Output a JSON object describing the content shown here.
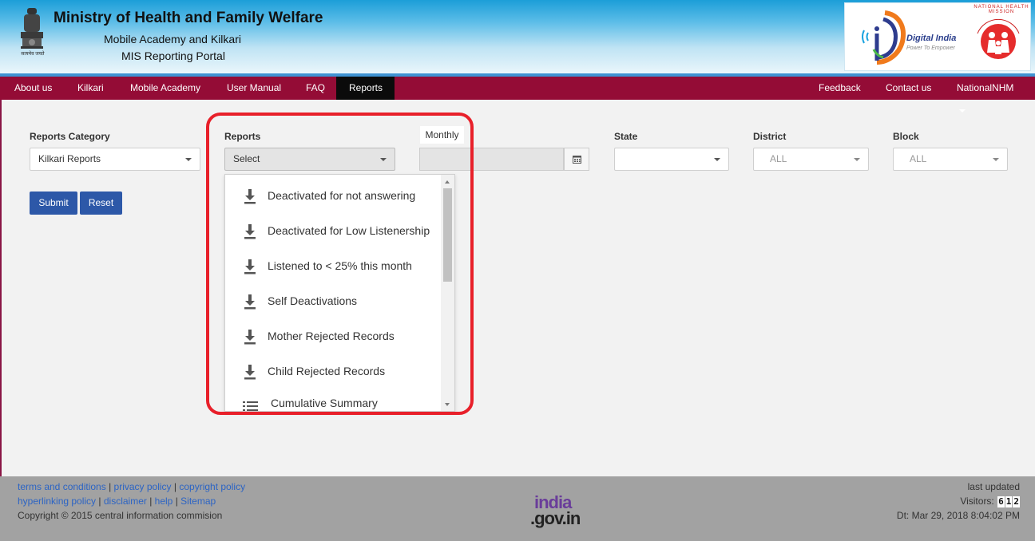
{
  "header": {
    "title": "Ministry of Health and Family Welfare",
    "subtitle1": "Mobile Academy and Kilkari",
    "subtitle2": "MIS Reporting Portal",
    "emblem_text": "सत्यमेव जयते",
    "digital_india": "Digital India",
    "digital_india_tagline": "Power To Empower",
    "nhm_text": "NATIONAL HEALTH MISSION"
  },
  "nav": {
    "left": [
      "About us",
      "Kilkari",
      "Mobile Academy",
      "User Manual",
      "FAQ",
      "Reports"
    ],
    "active": "Reports",
    "right": [
      "Feedback",
      "Contact us",
      "NationalNHM"
    ]
  },
  "filters": {
    "reports_category_label": "Reports Category",
    "reports_category_value": "Kilkari Reports",
    "reports_label": "Reports",
    "reports_value": "Select",
    "period_label": "Monthly",
    "state_label": "State",
    "state_value": "",
    "district_label": "District",
    "district_value": "ALL",
    "block_label": "Block",
    "block_value": "ALL"
  },
  "buttons": {
    "submit": "Submit",
    "reset": "Reset"
  },
  "dropdown": {
    "items": [
      {
        "label": "Deactivated for not answering",
        "icon": "download-icon"
      },
      {
        "label": "Deactivated for Low Listenership",
        "icon": "download-icon"
      },
      {
        "label": "Listened to < 25% this month",
        "icon": "download-icon"
      },
      {
        "label": "Self Deactivations",
        "icon": "download-icon"
      },
      {
        "label": "Mother Rejected Records",
        "icon": "download-icon"
      },
      {
        "label": "Child Rejected Records",
        "icon": "download-icon"
      },
      {
        "label": "Cumulative Summary",
        "icon": "list-icon"
      }
    ]
  },
  "footer": {
    "links_row1": [
      "terms and conditions",
      "privacy policy",
      "copyright policy"
    ],
    "links_row2": [
      "hyperlinking policy",
      "disclaimer",
      "help",
      "Sitemap"
    ],
    "copyright": "Copyright © 2015 central information commision",
    "india_logo_top": "india",
    "india_logo_bottom": ".gov.in",
    "last_updated": "last updated",
    "visitors_label": "Visitors:",
    "visitor_digits": [
      "6",
      "1",
      "2"
    ],
    "date": "Dt: Mar 29, 2018 8:04:02 PM"
  },
  "colors": {
    "navbar": "#940c36",
    "active_tab": "#0b0b0b",
    "button": "#2d58a8",
    "highlight": "#e8202a",
    "footer": "#a2a2a2",
    "link": "#2c64c4"
  }
}
